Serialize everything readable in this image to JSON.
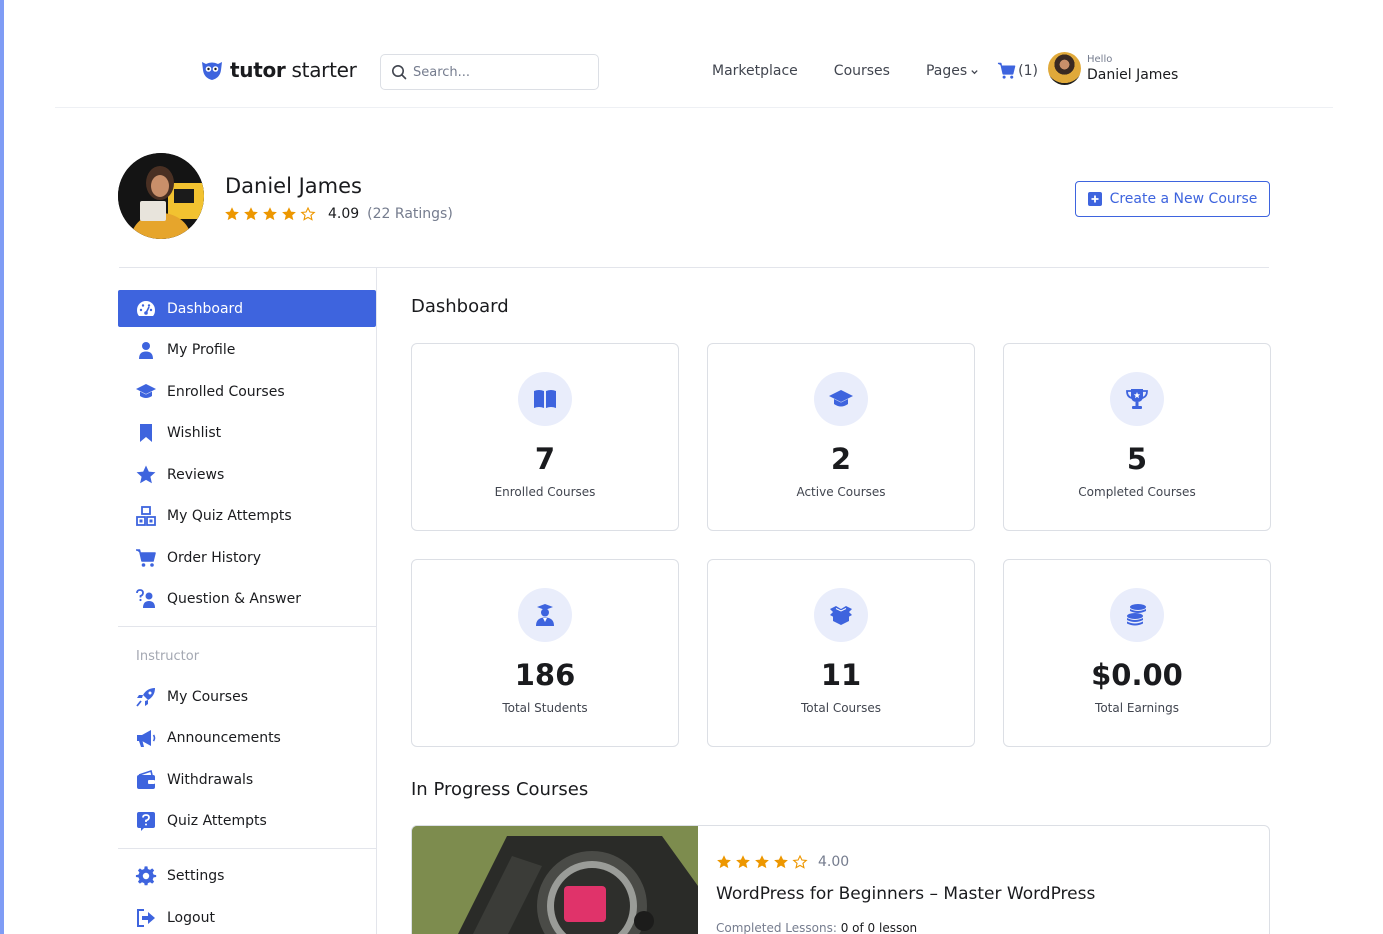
{
  "brand": {
    "name_bold": "tutor",
    "name_rest": " starter",
    "accent": "#3e64de"
  },
  "header": {
    "search_placeholder": "Search...",
    "nav": [
      "Marketplace",
      "Courses",
      "Pages"
    ],
    "cart_count": "(1)",
    "greeting": "Hello",
    "user_name": "Daniel James"
  },
  "profile": {
    "name": "Daniel James",
    "rating_value": "4.09",
    "rating_count": "(22 Ratings)",
    "stars_filled": 4,
    "create_button": "Create a New Course"
  },
  "sidebar": {
    "items": [
      {
        "label": "Dashboard",
        "icon": "dashboard-icon",
        "active": true
      },
      {
        "label": "My Profile",
        "icon": "user-icon"
      },
      {
        "label": "Enrolled Courses",
        "icon": "graduation-cap-icon"
      },
      {
        "label": "Wishlist",
        "icon": "bookmark-icon"
      },
      {
        "label": "Reviews",
        "icon": "star-icon"
      },
      {
        "label": "My Quiz Attempts",
        "icon": "quiz-icon"
      },
      {
        "label": "Order History",
        "icon": "cart-icon"
      },
      {
        "label": "Question & Answer",
        "icon": "question-icon"
      }
    ],
    "instructor_heading": "Instructor",
    "instructor_items": [
      {
        "label": "My Courses",
        "icon": "rocket-icon"
      },
      {
        "label": "Announcements",
        "icon": "megaphone-icon"
      },
      {
        "label": "Withdrawals",
        "icon": "wallet-icon"
      },
      {
        "label": "Quiz Attempts",
        "icon": "question-box-icon"
      }
    ],
    "bottom_items": [
      {
        "label": "Settings",
        "icon": "gear-icon"
      },
      {
        "label": "Logout",
        "icon": "logout-icon"
      }
    ]
  },
  "main": {
    "title": "Dashboard",
    "stats": [
      {
        "value": "7",
        "label": "Enrolled Courses",
        "icon": "book-icon"
      },
      {
        "value": "2",
        "label": "Active Courses",
        "icon": "graduation-cap-icon"
      },
      {
        "value": "5",
        "label": "Completed Courses",
        "icon": "trophy-icon"
      },
      {
        "value": "186",
        "label": "Total Students",
        "icon": "student-icon"
      },
      {
        "value": "11",
        "label": "Total Courses",
        "icon": "box-icon"
      },
      {
        "value": "$0.00",
        "label": "Total Earnings",
        "icon": "coins-icon"
      }
    ],
    "in_progress_title": "In Progress Courses",
    "course": {
      "rating": "4.00",
      "stars_filled": 4,
      "title": "WordPress for Beginners – Master WordPress",
      "lessons_label": "Completed Lessons:",
      "lessons_value": "0 of 0 lesson"
    }
  }
}
